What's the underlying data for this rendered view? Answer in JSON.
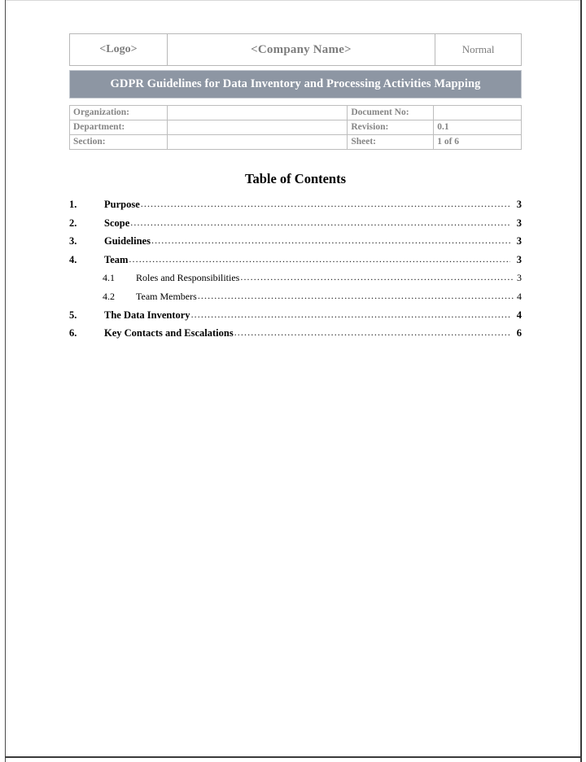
{
  "document": {
    "header": {
      "logo_placeholder": "<Logo>",
      "company_placeholder": "<Company Name>",
      "status": "Normal"
    },
    "title": "GDPR Guidelines for Data Inventory and Processing Activities Mapping",
    "title_bar_color": "#8d96a3",
    "info_table": {
      "rows": [
        {
          "label_left": "Organization:",
          "value_left": "",
          "label_right": "Document No:",
          "value_right": ""
        },
        {
          "label_left": "Department:",
          "value_left": "",
          "label_right": "Revision:",
          "value_right": "0.1"
        },
        {
          "label_left": "Section:",
          "value_left": "",
          "label_right": "Sheet:",
          "value_right": "1 of 6"
        }
      ]
    },
    "toc": {
      "heading": "Table of Contents",
      "entries": [
        {
          "number": "1.",
          "label": "Purpose",
          "page": "3",
          "level": 1
        },
        {
          "number": "2.",
          "label": "Scope",
          "page": "3",
          "level": 1
        },
        {
          "number": "3.",
          "label": "Guidelines",
          "page": "3",
          "level": 1
        },
        {
          "number": "4.",
          "label": "Team",
          "page": "3",
          "level": 1
        },
        {
          "number": "4.1",
          "label": "Roles and Responsibilities",
          "page": "3",
          "level": 2
        },
        {
          "number": "4.2",
          "label": "Team Members",
          "page": "4",
          "level": 2
        },
        {
          "number": "5.",
          "label": "The Data Inventory",
          "page": "4",
          "level": 1
        },
        {
          "number": "6.",
          "label": "Key Contacts and Escalations",
          "page": "6",
          "level": 1
        }
      ]
    }
  }
}
